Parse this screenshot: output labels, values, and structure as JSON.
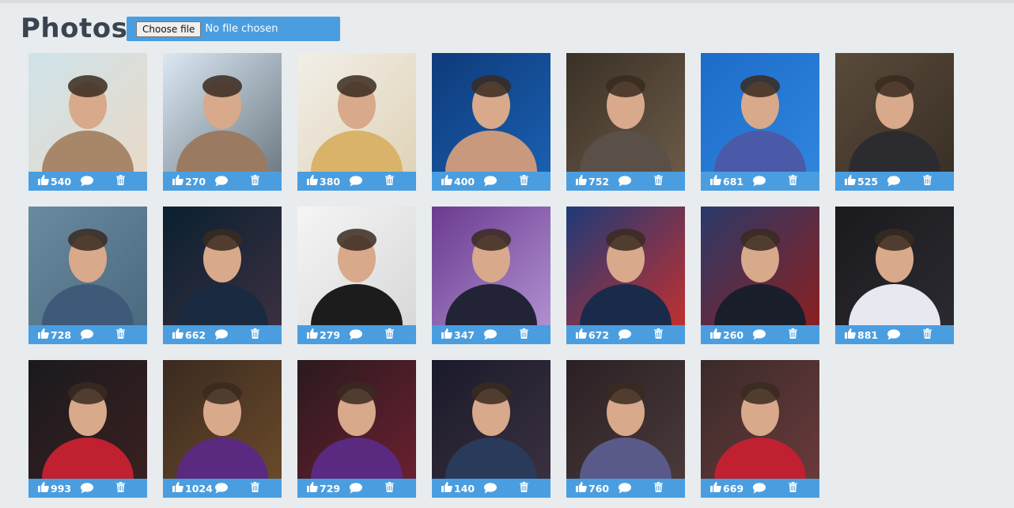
{
  "page": {
    "title": "Photos"
  },
  "upload": {
    "button_label": "Choose file",
    "status": "No file chosen"
  },
  "colors": {
    "accent": "#4a9ee0",
    "background": "#e8ecee",
    "title": "#3a4450"
  },
  "icons": {
    "like": "thumbs-up-icon",
    "comment": "comment-bubble-icon",
    "delete": "trash-icon"
  },
  "photos": [
    {
      "likes": "540",
      "bg": [
        "#cfe3ea",
        "#e8d9c8"
      ],
      "subject": "#a8866a"
    },
    {
      "likes": "270",
      "bg": [
        "#dbe8f3",
        "#6f7c86"
      ],
      "subject": "#9b7a62"
    },
    {
      "likes": "380",
      "bg": [
        "#f2efe8",
        "#e0d3b8"
      ],
      "subject": "#d9b36a"
    },
    {
      "likes": "400",
      "bg": [
        "#0e3a7a",
        "#1a5fb0"
      ],
      "subject": "#c9997e"
    },
    {
      "likes": "752",
      "bg": [
        "#3a3026",
        "#6b5a48"
      ],
      "subject": "#5a5048"
    },
    {
      "likes": "681",
      "bg": [
        "#1c6cc8",
        "#2f85de"
      ],
      "subject": "#4a5aa8"
    },
    {
      "likes": "525",
      "bg": [
        "#5a4a3a",
        "#3a3026"
      ],
      "subject": "#2c2c30"
    },
    {
      "likes": "728",
      "bg": [
        "#6b8aa0",
        "#4a6a80"
      ],
      "subject": "#3e5a78"
    },
    {
      "likes": "662",
      "bg": [
        "#0a2030",
        "#3a3040"
      ],
      "subject": "#1a2a40"
    },
    {
      "likes": "279",
      "bg": [
        "#f5f5f5",
        "#d8d8d8"
      ],
      "subject": "#1c1c1c"
    },
    {
      "likes": "347",
      "bg": [
        "#6a3a90",
        "#b090d0"
      ],
      "subject": "#222436"
    },
    {
      "likes": "672",
      "bg": [
        "#1e3a78",
        "#c03030"
      ],
      "subject": "#1a2a4a"
    },
    {
      "likes": "260",
      "bg": [
        "#2a3a6a",
        "#8a2020"
      ],
      "subject": "#1a1e2a"
    },
    {
      "likes": "881",
      "bg": [
        "#1a1a1e",
        "#2a2a30"
      ],
      "subject": "#e8e8f0"
    },
    {
      "likes": "993",
      "bg": [
        "#1a1a1e",
        "#3a2020"
      ],
      "subject": "#c02030"
    },
    {
      "likes": "1024",
      "bg": [
        "#3a2a20",
        "#6a4a2a"
      ],
      "subject": "#5a2a80"
    },
    {
      "likes": "729",
      "bg": [
        "#2a1a1e",
        "#6a2030"
      ],
      "subject": "#5a2a80"
    },
    {
      "likes": "140",
      "bg": [
        "#1a1a2a",
        "#3a3040"
      ],
      "subject": "#2a3a5a"
    },
    {
      "likes": "760",
      "bg": [
        "#2a2024",
        "#4a3a3a"
      ],
      "subject": "#5a5a8a"
    },
    {
      "likes": "669",
      "bg": [
        "#3a2a2a",
        "#6a3a3a"
      ],
      "subject": "#c02030"
    }
  ]
}
